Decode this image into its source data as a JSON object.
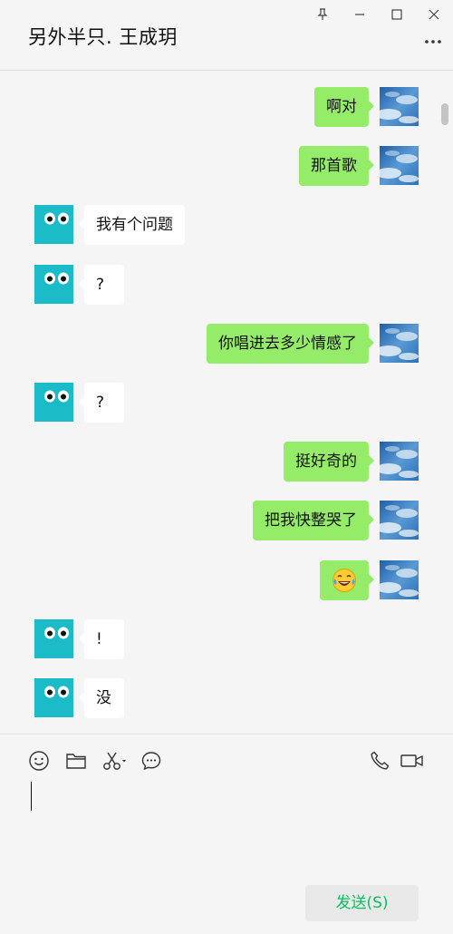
{
  "window": {
    "title": "另外半只. 王成玥",
    "controls": [
      "pin-icon",
      "minimize-icon",
      "maximize-icon",
      "close-icon"
    ],
    "more_icon": "more-icon"
  },
  "messages": [
    {
      "side": "mine",
      "text": "啊对"
    },
    {
      "side": "mine",
      "text": "那首歌"
    },
    {
      "side": "theirs",
      "text": "我有个问题"
    },
    {
      "side": "theirs",
      "text": "?"
    },
    {
      "side": "mine",
      "text": "你唱进去多少情感了"
    },
    {
      "side": "theirs",
      "text": "?"
    },
    {
      "side": "mine",
      "text": "挺好奇的"
    },
    {
      "side": "mine",
      "text": "把我快整哭了"
    },
    {
      "side": "mine",
      "text": "",
      "emoji": "tears-of-joy"
    },
    {
      "side": "theirs",
      "text": "!"
    },
    {
      "side": "theirs",
      "text": "没"
    }
  ],
  "toolbar": {
    "left_tools": [
      "emoji-icon",
      "folder-icon",
      "scissors-icon",
      "chat-bubble-icon"
    ],
    "right_tools": [
      "phone-icon",
      "video-icon"
    ]
  },
  "composer": {
    "value": "",
    "send_label": "发送(S)"
  },
  "colors": {
    "background": "#f5f5f5",
    "my_bubble": "#95ec69",
    "their_bubble": "#ffffff",
    "their_avatar": "#1bbcc8",
    "send_text": "#07c160"
  }
}
